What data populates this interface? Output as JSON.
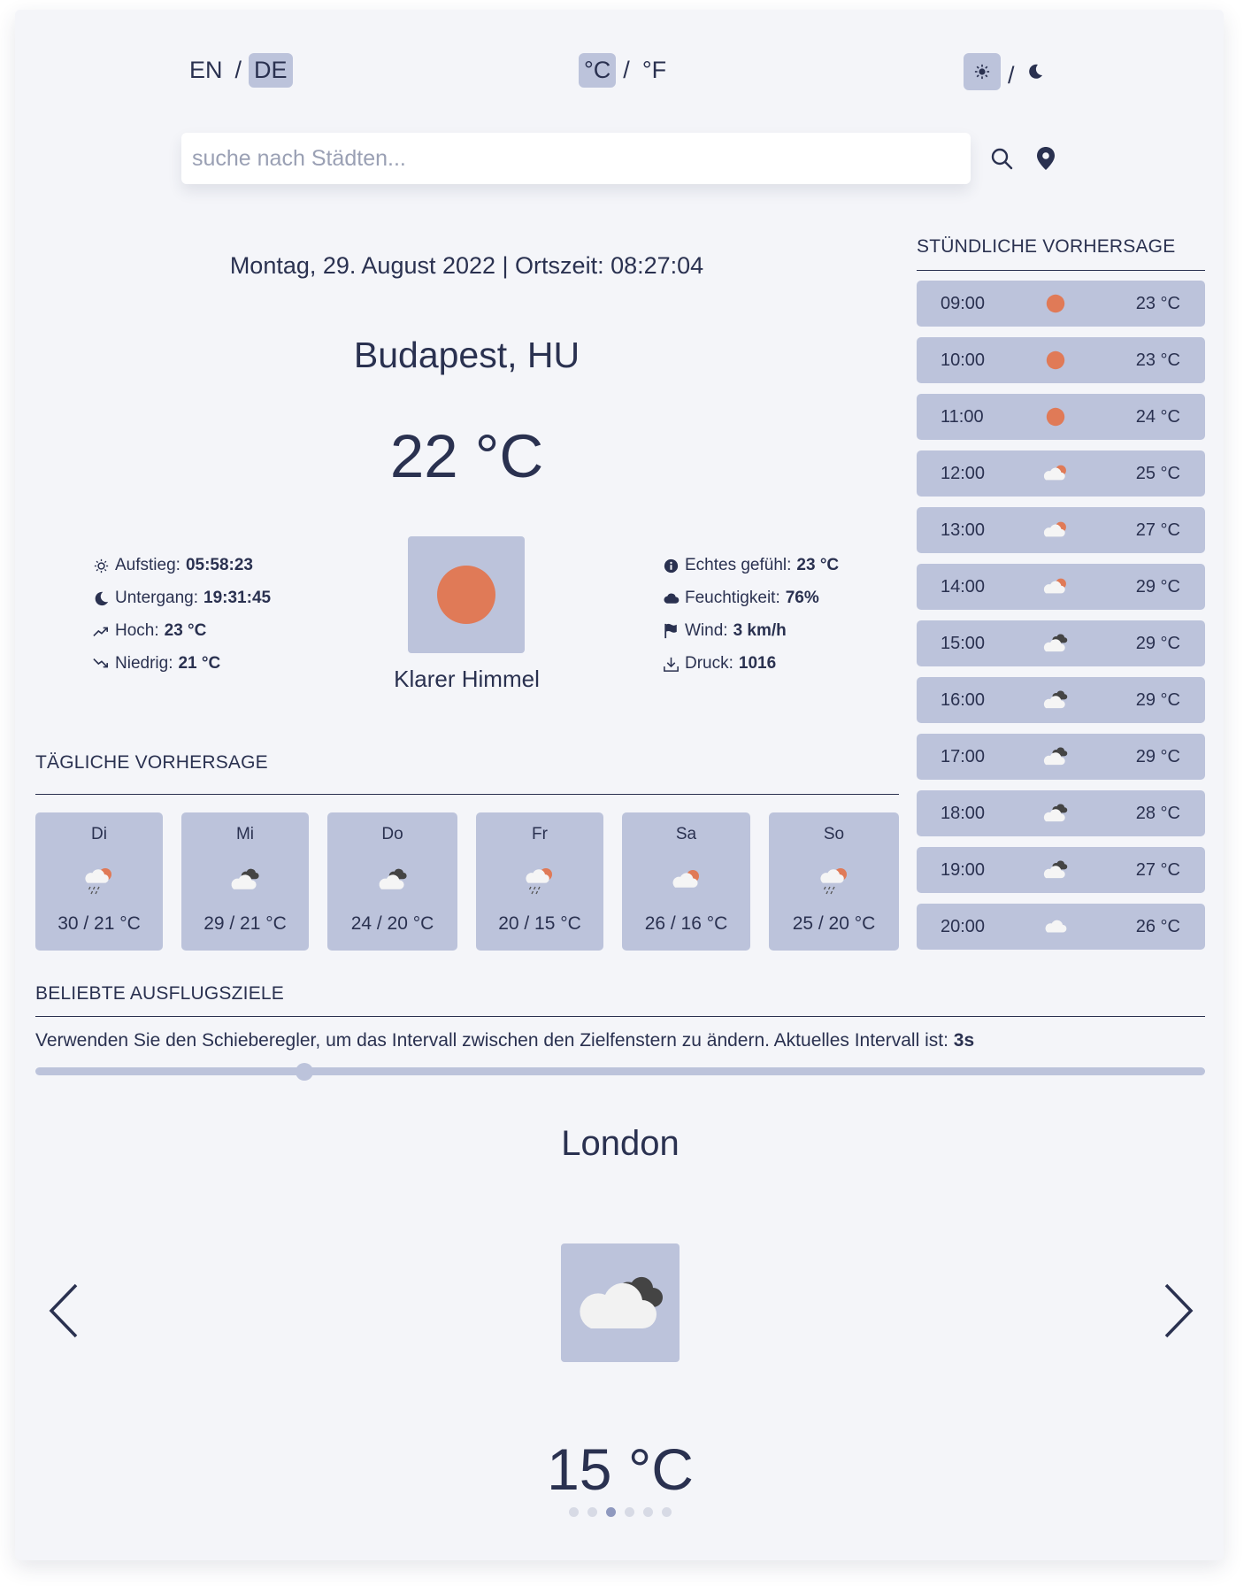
{
  "language": {
    "options": [
      "EN",
      "DE"
    ],
    "active": "DE",
    "separator": "/"
  },
  "units": {
    "options": [
      "°C",
      "°F"
    ],
    "active": "°C",
    "separator": "/"
  },
  "theme": {
    "separator": "/"
  },
  "search": {
    "placeholder": "suche nach Städten..."
  },
  "current": {
    "datetime": "Montag, 29. August 2022 | Ortszeit: 08:27:04",
    "city": "Budapest, HU",
    "temp": "22 °C",
    "condition": "Klarer Himmel",
    "details_left": [
      {
        "icon": "sun-icon",
        "label": "Aufstieg:",
        "value": "05:58:23"
      },
      {
        "icon": "moon-icon",
        "label": "Untergang:",
        "value": "19:31:45"
      },
      {
        "icon": "trend-up-icon",
        "label": "Hoch:",
        "value": "23 °C"
      },
      {
        "icon": "trend-down-icon",
        "label": "Niedrig:",
        "value": "21 °C"
      }
    ],
    "details_right": [
      {
        "icon": "info-icon",
        "label": "Echtes gefühl:",
        "value": "23 °C"
      },
      {
        "icon": "cloud-icon",
        "label": "Feuchtigkeit:",
        "value": "76%"
      },
      {
        "icon": "flag-icon",
        "label": "Wind:",
        "value": "3 km/h"
      },
      {
        "icon": "download-icon",
        "label": "Druck:",
        "value": "1016"
      }
    ]
  },
  "hourly": {
    "title": "STÜNDLICHE VORHERSAGE",
    "items": [
      {
        "time": "09:00",
        "icon": "sun",
        "temp": "23 °C"
      },
      {
        "time": "10:00",
        "icon": "sun",
        "temp": "23 °C"
      },
      {
        "time": "11:00",
        "icon": "sun",
        "temp": "24 °C"
      },
      {
        "time": "12:00",
        "icon": "partly-cloudy",
        "temp": "25 °C"
      },
      {
        "time": "13:00",
        "icon": "partly-cloudy",
        "temp": "27 °C"
      },
      {
        "time": "14:00",
        "icon": "partly-cloudy",
        "temp": "29 °C"
      },
      {
        "time": "15:00",
        "icon": "broken-clouds",
        "temp": "29 °C"
      },
      {
        "time": "16:00",
        "icon": "broken-clouds",
        "temp": "29 °C"
      },
      {
        "time": "17:00",
        "icon": "broken-clouds",
        "temp": "29 °C"
      },
      {
        "time": "18:00",
        "icon": "broken-clouds",
        "temp": "28 °C"
      },
      {
        "time": "19:00",
        "icon": "broken-clouds",
        "temp": "27 °C"
      },
      {
        "time": "20:00",
        "icon": "cloud",
        "temp": "26 °C"
      }
    ]
  },
  "daily": {
    "title": "TÄGLICHE VORHERSAGE",
    "items": [
      {
        "day": "Di",
        "icon": "rain-sun",
        "temp": "30 / 21 °C"
      },
      {
        "day": "Mi",
        "icon": "broken-clouds",
        "temp": "29 / 21 °C"
      },
      {
        "day": "Do",
        "icon": "broken-clouds",
        "temp": "24 / 20 °C"
      },
      {
        "day": "Fr",
        "icon": "rain-sun",
        "temp": "20 / 15 °C"
      },
      {
        "day": "Sa",
        "icon": "partly-cloudy",
        "temp": "26 / 16 °C"
      },
      {
        "day": "So",
        "icon": "rain-sun",
        "temp": "25 / 20 °C"
      }
    ]
  },
  "popular": {
    "title": "BELIEBTE AUSFLUGSZIELE",
    "description": "Verwenden Sie den Schieberegler, um das Intervall zwischen den Zielfenstern zu ändern. Aktuelles Intervall ist:",
    "interval": "3s",
    "slider_value": 0.23,
    "city": "London",
    "icon": "broken-clouds",
    "temp": "15 °C",
    "dots": {
      "count": 6,
      "active": 2
    }
  },
  "colors": {
    "accent": "#bcc3db",
    "sun": "#e07a57",
    "text": "#2a3150",
    "background": "#f4f5f9"
  }
}
